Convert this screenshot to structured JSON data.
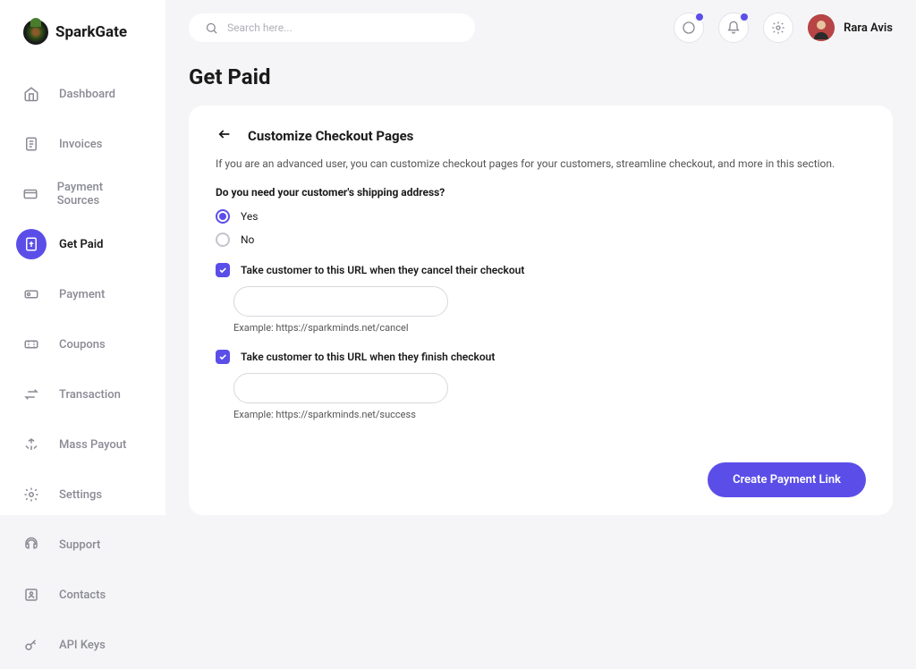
{
  "brand": {
    "name": "SparkGate"
  },
  "search": {
    "placeholder": "Search here..."
  },
  "user": {
    "name": "Rara Avis"
  },
  "sidebar": {
    "items": [
      {
        "label": "Dashboard",
        "icon": "home-icon"
      },
      {
        "label": "Invoices",
        "icon": "invoice-icon"
      },
      {
        "label": "Payment Sources",
        "icon": "card-icon"
      },
      {
        "label": "Get Paid",
        "icon": "paid-icon"
      },
      {
        "label": "Payment",
        "icon": "payment-icon"
      },
      {
        "label": "Coupons",
        "icon": "coupon-icon"
      },
      {
        "label": "Transaction",
        "icon": "transaction-icon"
      },
      {
        "label": "Mass Payout",
        "icon": "payout-icon"
      },
      {
        "label": "Settings",
        "icon": "settings-icon"
      },
      {
        "label": "Support",
        "icon": "support-icon"
      },
      {
        "label": "Contacts",
        "icon": "contacts-icon"
      },
      {
        "label": "API  Keys",
        "icon": "key-icon"
      }
    ],
    "activeIndex": 3
  },
  "page": {
    "title": "Get Paid",
    "card": {
      "title": "Customize Checkout Pages",
      "description": "If you are an advanced user,  you can customize checkout pages for your customers, streamline checkout, and more in this section.",
      "question": "Do you need your customer's shipping address?",
      "radios": {
        "yes": "Yes",
        "no": "No",
        "selected": "yes"
      },
      "cancelCheck": {
        "label": "Take customer to this URL when they cancel their checkout",
        "checked": true,
        "value": "",
        "example": "Example: https://sparkminds.net/cancel"
      },
      "finishCheck": {
        "label": "Take customer to this URL when they finish checkout",
        "checked": true,
        "value": "",
        "example": "Example: https://sparkminds.net/success"
      },
      "submitLabel": "Create Payment Link"
    }
  }
}
